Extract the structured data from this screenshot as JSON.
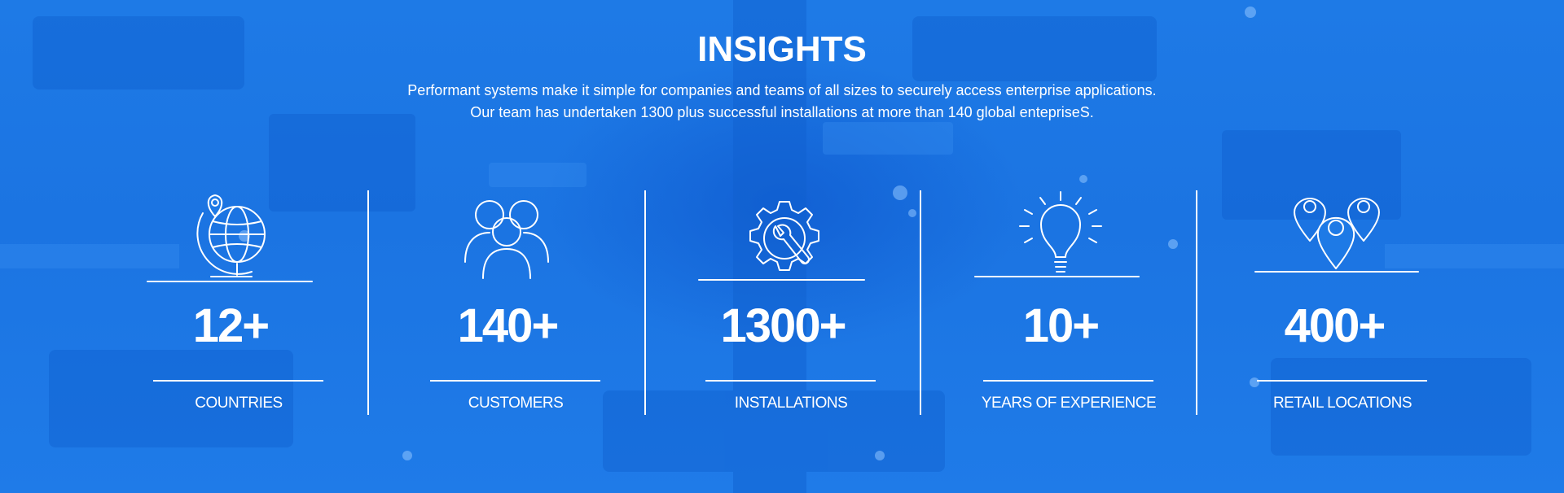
{
  "section": {
    "title": "INSIGHTS",
    "intro_line_1": "Performant systems make it simple for companies and teams of all sizes to securely access enterprise applications.",
    "intro_line_2": "Our team has undertaken 1300 plus successful installations at more than 140 global entepriseS."
  },
  "stats": [
    {
      "value": "12+",
      "label": "COUNTRIES",
      "icon": "globe-pin-icon"
    },
    {
      "value": "140+",
      "label": "CUSTOMERS",
      "icon": "people-group-icon"
    },
    {
      "value": "1300+",
      "label": "INSTALLATIONS",
      "icon": "gear-wrench-icon"
    },
    {
      "value": "10+",
      "label": "YEARS OF EXPERIENCE",
      "icon": "lightbulb-icon"
    },
    {
      "value": "400+",
      "label": "RETAIL LOCATIONS",
      "icon": "location-pins-icon"
    }
  ],
  "colors": {
    "background": "#1e7ae6",
    "foreground": "#ffffff"
  }
}
